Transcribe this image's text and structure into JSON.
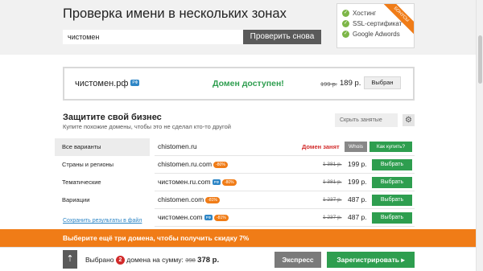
{
  "header": {
    "title": "Проверка имени в нескольких зонах",
    "search_value": "чистомен",
    "check_button": "Проверить снова"
  },
  "promo": {
    "items": [
      "Хостинг",
      "SSL-сертификат",
      "Google Adwords"
    ],
    "ribbon": "БОНУСЫ"
  },
  "available": {
    "domain": "чистомен.рф",
    "domain_badge": "РФ",
    "status": "Домен доступен!",
    "old_price": "199 р.",
    "price": "189 р.",
    "chosen_button": "Выбран"
  },
  "protect": {
    "title": "Защитите свой бизнес",
    "subtitle": "Купите похожие домены, чтобы это не сделал кто-то другой",
    "hide_button": "Скрыть занятые"
  },
  "categories": [
    "Все варианты",
    "Страны и регионы",
    "Тематические",
    "Вариации"
  ],
  "save_link": "Сохранить результаты в файл",
  "rows": [
    {
      "name": "chistomen.ru",
      "busy": "Домен занят",
      "whois": "Whois",
      "how_buy": "Как купить?"
    },
    {
      "name": "chistomen.ru.com",
      "discount": "-80%",
      "old_price": "1 381 р.",
      "price": "199 р.",
      "select": "Выбрать"
    },
    {
      "name": "чистомен.ru.com",
      "badge": "РФ",
      "discount": "-80%",
      "old_price": "1 381 р.",
      "price": "199 р.",
      "select": "Выбрать"
    },
    {
      "name": "chistomen.com",
      "discount": "-81%",
      "old_price": "1 237 р.",
      "price": "487 р.",
      "select": "Выбрать"
    },
    {
      "name": "чистомен.com",
      "badge": "РФ",
      "discount": "-81%",
      "old_price": "1 237 р.",
      "price": "487 р.",
      "select": "Выбрать"
    }
  ],
  "offer": "Выберите ещё три домена, чтобы получить скидку 7%",
  "footer": {
    "selected_label": "Выбрано",
    "count": "2",
    "sum_label": "домена на сумму:",
    "sum_old": "398",
    "sum_new": "378 р.",
    "express_button": "Экспресс",
    "register_button": "Зарегистрировать ▸"
  },
  "colors": {
    "accent_orange": "#f07c17",
    "green": "#2e9e4f",
    "red": "#d22a2a",
    "blue": "#2e86c6",
    "dark_button": "#5a5a5a"
  }
}
